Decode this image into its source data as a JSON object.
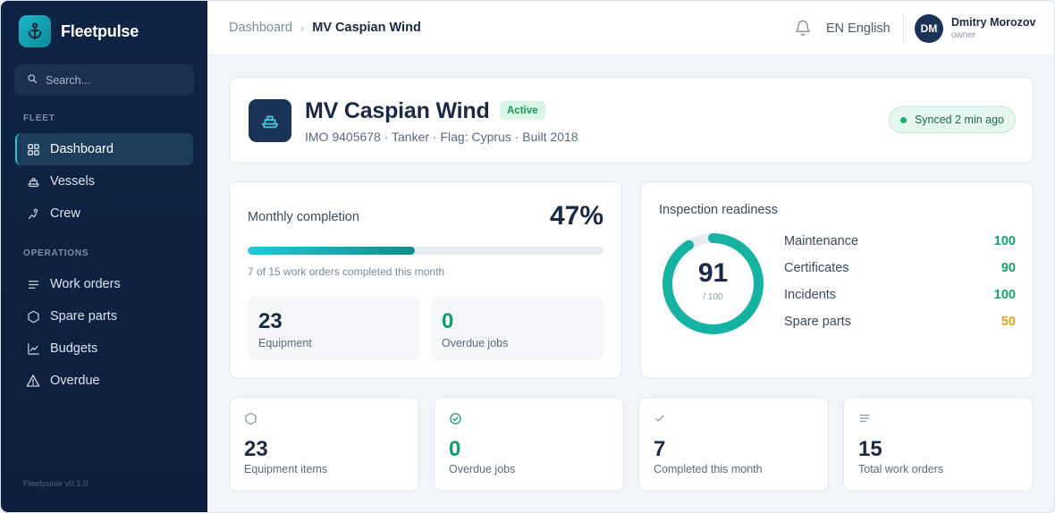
{
  "brand": {
    "name": "Fleetpulse",
    "version": "Fleetpulse v0.1.0"
  },
  "search": {
    "placeholder": "Search..."
  },
  "sidebar": {
    "sections": [
      {
        "label": "FLEET",
        "items": [
          {
            "label": "Dashboard",
            "icon": "grid-icon",
            "active": true
          },
          {
            "label": "Vessels",
            "icon": "ship-icon"
          },
          {
            "label": "Crew",
            "icon": "crew-icon"
          }
        ]
      },
      {
        "label": "OPERATIONS",
        "items": [
          {
            "label": "Work orders",
            "icon": "list-icon"
          },
          {
            "label": "Spare parts",
            "icon": "hexagon-icon"
          },
          {
            "label": "Budgets",
            "icon": "chart-icon"
          },
          {
            "label": "Overdue",
            "icon": "warning-icon"
          }
        ]
      }
    ]
  },
  "topbar": {
    "breadcrumb": [
      "Dashboard",
      "MV Caspian Wind"
    ],
    "language": "EN English",
    "user": {
      "initials": "DM",
      "name": "Dmitry Morozov",
      "role": "owner"
    }
  },
  "vessel": {
    "name": "MV Caspian Wind",
    "status": "Active",
    "meta": "IMO 9405678 · Tanker · Flag: Cyprus · Built 2018",
    "sync": "Synced 2 min ago"
  },
  "monthly": {
    "title": "Monthly completion",
    "percent_label": "47%",
    "progress": 0.47,
    "subtitle": "7 of 15 work orders completed this month",
    "minis": [
      {
        "value": "23",
        "label": "Equipment",
        "color": "#1b2a45"
      },
      {
        "value": "0",
        "label": "Overdue jobs",
        "color": "#159a6a"
      }
    ]
  },
  "readiness": {
    "title": "Inspection readiness",
    "score": "91",
    "score_value": 91,
    "denominator": "/ 100",
    "ring_color": "#16b3a2",
    "rows": [
      {
        "label": "Maintenance",
        "value": "100",
        "color": "#16a36d"
      },
      {
        "label": "Certificates",
        "value": "90",
        "color": "#16a36d"
      },
      {
        "label": "Incidents",
        "value": "100",
        "color": "#16a36d"
      },
      {
        "label": "Spare parts",
        "value": "50",
        "color": "#e9a018"
      }
    ]
  },
  "stats": [
    {
      "value": "23",
      "label": "Equipment items",
      "icon": "hexagon-icon",
      "color": "#1b2a45"
    },
    {
      "value": "0",
      "label": "Overdue jobs",
      "icon": "check-circle-icon",
      "color": "#159a6a"
    },
    {
      "value": "7",
      "label": "Completed this month",
      "icon": "check-icon",
      "color": "#1b2a45"
    },
    {
      "value": "15",
      "label": "Total work orders",
      "icon": "list-icon",
      "color": "#1b2a45"
    }
  ]
}
